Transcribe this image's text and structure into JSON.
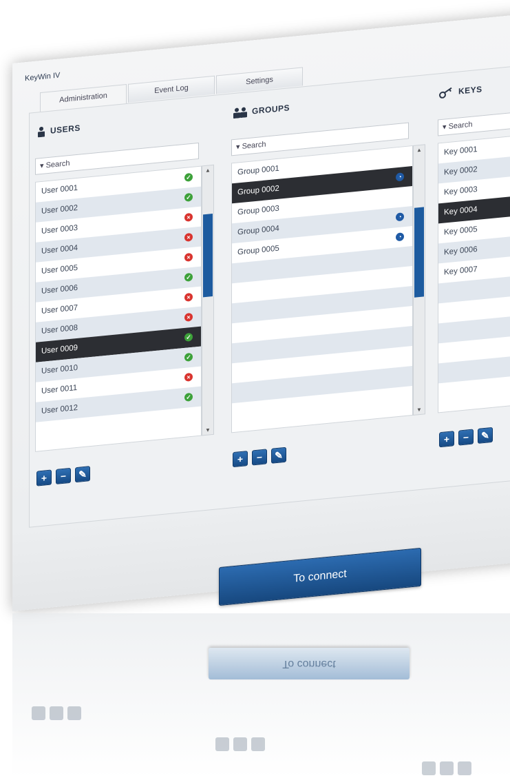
{
  "app": {
    "title": "KeyWin IV"
  },
  "tabs": [
    {
      "label": "Administration"
    },
    {
      "label": "Event Log"
    },
    {
      "label": "Settings"
    }
  ],
  "users": {
    "title": "USERS",
    "search": "▾ Search",
    "items": [
      {
        "name": "User 0001",
        "status": "ok"
      },
      {
        "name": "User 0002",
        "status": "ok"
      },
      {
        "name": "User 0003",
        "status": "no"
      },
      {
        "name": "User 0004",
        "status": "no"
      },
      {
        "name": "User 0005",
        "status": "no"
      },
      {
        "name": "User 0006",
        "status": "ok"
      },
      {
        "name": "User 0007",
        "status": "no"
      },
      {
        "name": "User 0008",
        "status": "no"
      },
      {
        "name": "User 0009",
        "status": "ok",
        "selected": true
      },
      {
        "name": "User 0010",
        "status": "ok"
      },
      {
        "name": "User 0011",
        "status": "no"
      },
      {
        "name": "User 0012",
        "status": "ok"
      }
    ]
  },
  "groups": {
    "title": "GROUPS",
    "search": "▾ Search",
    "items": [
      {
        "name": "Group 0001"
      },
      {
        "name": "Group 0002",
        "selected": true,
        "clock": true
      },
      {
        "name": "Group 0003"
      },
      {
        "name": "Group 0004",
        "clock": true
      },
      {
        "name": "Group 0005",
        "clock": true
      }
    ]
  },
  "keys": {
    "title": "KEYS",
    "search": "▾ Search",
    "items": [
      {
        "name": "Key 0001"
      },
      {
        "name": "Key 0002"
      },
      {
        "name": "Key 0003"
      },
      {
        "name": "Key 0004",
        "selected": true
      },
      {
        "name": "Key 0005"
      },
      {
        "name": "Key 0006"
      },
      {
        "name": "Key 0007"
      }
    ]
  },
  "buttons": {
    "add": "+",
    "remove": "−",
    "edit": "✎"
  },
  "connect": {
    "label": "To connect"
  },
  "reflection": {
    "connect_label": "To connect"
  },
  "colors": {
    "accent": "#1d5b9f",
    "selected_row": "#2c2e33",
    "ok": "#3da13a",
    "error": "#d9342f"
  }
}
